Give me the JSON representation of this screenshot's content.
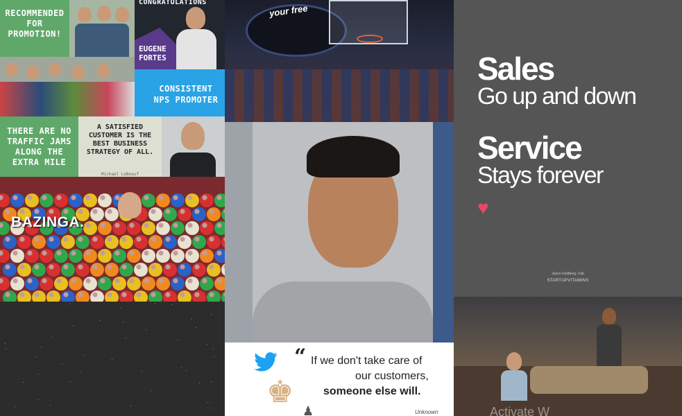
{
  "collage": {
    "promotion_tile": {
      "text": "RECOMMENDED FOR PROMOTION!"
    },
    "congrats_tile": {
      "title": "CONGRATULATIONS",
      "name": "EUGENE FORTES"
    },
    "nps_tile": {
      "text": "CONSISTENT NPS PROMOTER"
    },
    "traffic_tile": {
      "text": "THERE ARE NO TRAFFIC JAMS ALONG THE EXTRA MILE"
    },
    "customer_quote_tile": {
      "text": "A SATISFIED CUSTOMER IS THE BEST BUSINESS STRATEGY OF ALL.",
      "author": "Michael LeBoeuf"
    },
    "bazinga_tile": {
      "text": "BAZINGA."
    },
    "arena_tile": {
      "banner": "your free"
    },
    "sales_tile": {
      "line1_bold": "Sales",
      "line1_sub": "Go up and down",
      "line2_bold": "Service",
      "line2_sub": "Stays forever",
      "credit": "Jason Goldberg, Fab",
      "brand": "STARTUPVITAMINS"
    },
    "twitter_quote_tile": {
      "quote_line1": "If we don't take care of",
      "quote_line2": "our customers,",
      "quote_line3": "someone else will.",
      "author": "Unknown"
    },
    "tv_tile": {
      "watermark": "Activate W"
    }
  },
  "colors": {
    "green": "#5fa86a",
    "blue": "#29a3e6",
    "sales_bg": "#555555",
    "heart": "#e8476a",
    "twitter": "#1da1f2"
  }
}
